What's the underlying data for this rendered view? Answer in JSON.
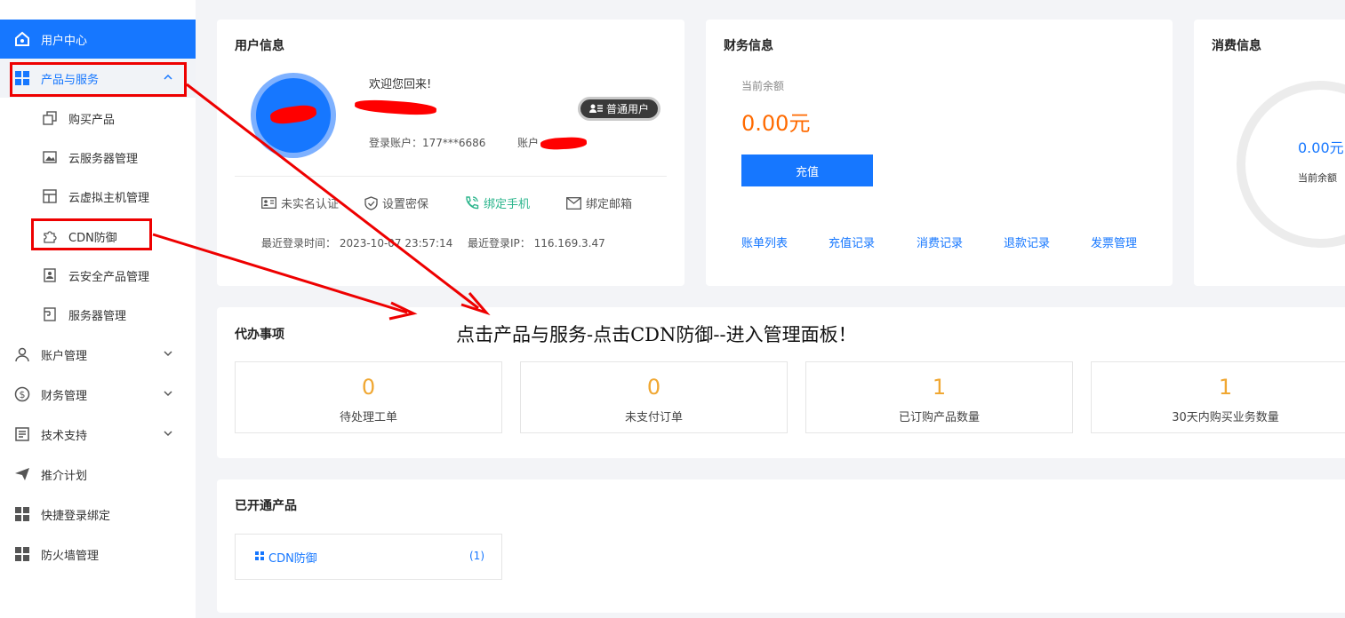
{
  "sidebar": {
    "items": [
      {
        "label": "用户中心",
        "icon": "home-icon"
      },
      {
        "label": "产品与服务",
        "icon": "grid-icon"
      },
      {
        "label": "账户管理",
        "icon": "user-icon"
      },
      {
        "label": "财务管理",
        "icon": "dollar-icon"
      },
      {
        "label": "技术支持",
        "icon": "document-icon"
      },
      {
        "label": "推介计划",
        "icon": "paper-plane-icon"
      },
      {
        "label": "快捷登录绑定",
        "icon": "grid-icon"
      },
      {
        "label": "防火墙管理",
        "icon": "grid-icon"
      }
    ],
    "sub_items": [
      {
        "label": "购买产品",
        "icon": "copy-icon"
      },
      {
        "label": "云服务器管理",
        "icon": "image-icon"
      },
      {
        "label": "云虚拟主机管理",
        "icon": "layout-icon"
      },
      {
        "label": "CDN防御",
        "icon": "puzzle-icon"
      },
      {
        "label": "云安全产品管理",
        "icon": "security-icon"
      },
      {
        "label": "服务器管理",
        "icon": "server-icon"
      }
    ]
  },
  "user_info": {
    "title": "用户信息",
    "welcome": "欢迎您回来!",
    "badge": "普通用户",
    "login_account": "登录账户：177***6686",
    "account_prefix": "账户",
    "actions": [
      "未实名认证",
      "设置密保",
      "绑定手机",
      "绑定邮箱"
    ],
    "last_login_time": "最近登录时间：  2023-10-07 23:57:14",
    "last_login_ip": "最近登录IP：  116.169.3.47"
  },
  "finance": {
    "title": "财务信息",
    "balance_label": "当前余额",
    "balance": "0.00元",
    "recharge_button": "充值",
    "links": [
      "账单列表",
      "充值记录",
      "消费记录",
      "退款记录",
      "发票管理"
    ]
  },
  "consume": {
    "title": "消费信息",
    "amount": "0.00元",
    "label": "当前余额"
  },
  "todo": {
    "title": "代办事项",
    "items": [
      {
        "value": "0",
        "label": "待处理工单"
      },
      {
        "value": "0",
        "label": "未支付订单"
      },
      {
        "value": "1",
        "label": "已订购产品数量"
      },
      {
        "value": "1",
        "label": "30天内购买业务数量"
      }
    ]
  },
  "products": {
    "title": "已开通产品",
    "item_name": "CDN防御",
    "item_count": "(1)"
  },
  "annotation": "点击产品与服务-点击CDN防御--进入管理面板！",
  "colors": {
    "primary": "#1677ff",
    "balance": "#ff6a00",
    "todo_number": "#f0a732",
    "annotation": "#e00000",
    "bind_phone": "#2bb58c"
  }
}
